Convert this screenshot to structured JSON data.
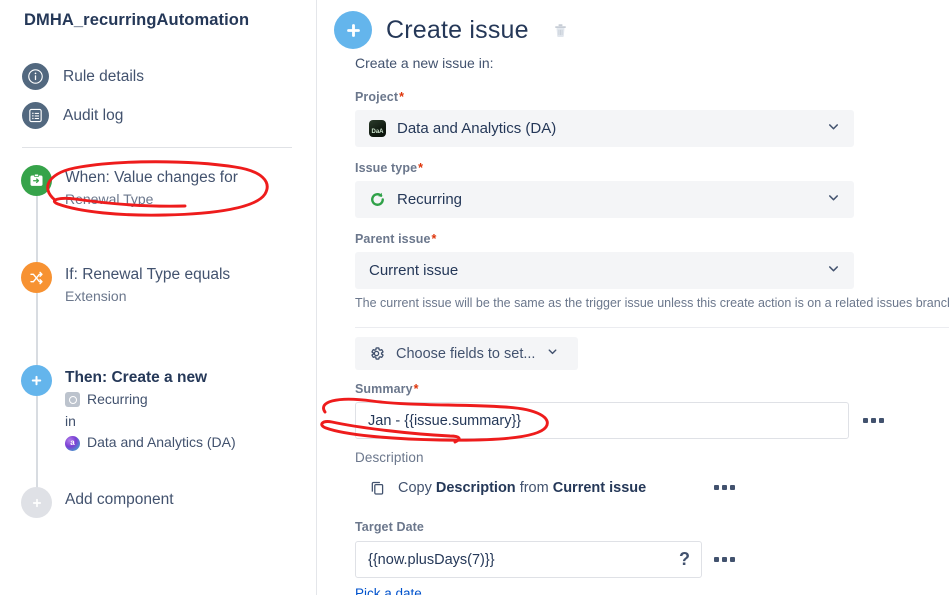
{
  "sidebar": {
    "rule_title": "DMHA_recurringAutomation",
    "nav": [
      {
        "label": "Rule details",
        "icon": "info-icon"
      },
      {
        "label": "Audit log",
        "icon": "list-icon"
      }
    ],
    "workflow": [
      {
        "title": "When: Value changes for",
        "subtitle": "Renewal Type",
        "icon": "trigger-icon",
        "color": "#36a34a"
      },
      {
        "title": "If: Renewal Type equals",
        "subtitle": "Extension",
        "icon": "condition-shuffle-icon",
        "color": "#f79232"
      },
      {
        "title": "Then: Create a new",
        "sub_issue_type": "Recurring",
        "sub_joiner": "in",
        "sub_project": "Data and Analytics (DA)",
        "icon": "action-plus-icon",
        "color": "#64b5ec"
      }
    ],
    "add_component": {
      "label": "Add component",
      "icon": "plus-icon"
    }
  },
  "main": {
    "header": {
      "title": "Create issue",
      "icon": "plus-circle-icon",
      "delete_icon": "trash-icon"
    },
    "intro": "Create a new issue in:",
    "fields": {
      "project": {
        "label": "Project",
        "required": true,
        "value": "Data and Analytics (DA)",
        "icon": "project-avatar-icon"
      },
      "issue_type": {
        "label": "Issue type",
        "required": true,
        "value": "Recurring",
        "icon": "recurring-issue-type-icon"
      },
      "parent_issue": {
        "label": "Parent issue",
        "required": true,
        "value": "Current issue",
        "helper": "The current issue will be the same as the trigger issue unless this create action is on a related issues branch."
      },
      "choose_fields": {
        "label": "Choose fields to set...",
        "icon": "gear-icon"
      },
      "summary": {
        "label": "Summary",
        "required": true,
        "value": "Jan - {{issue.summary}}"
      },
      "description": {
        "label": "Description",
        "copy_prefix": "Copy",
        "copy_field": "Description",
        "copy_middle": "from",
        "copy_source": "Current issue",
        "icon": "copy-icon"
      },
      "target_date": {
        "label": "Target Date",
        "value": "{{now.plusDays(7)}}",
        "help_icon": "question-mark-icon",
        "pick_link": "Pick a date"
      }
    },
    "more_menu_icon": "more-options-icon"
  },
  "annotations": {
    "color": "#ee1c1c",
    "shapes": [
      "ellipse-around-trigger",
      "ellipse-around-summary"
    ]
  }
}
